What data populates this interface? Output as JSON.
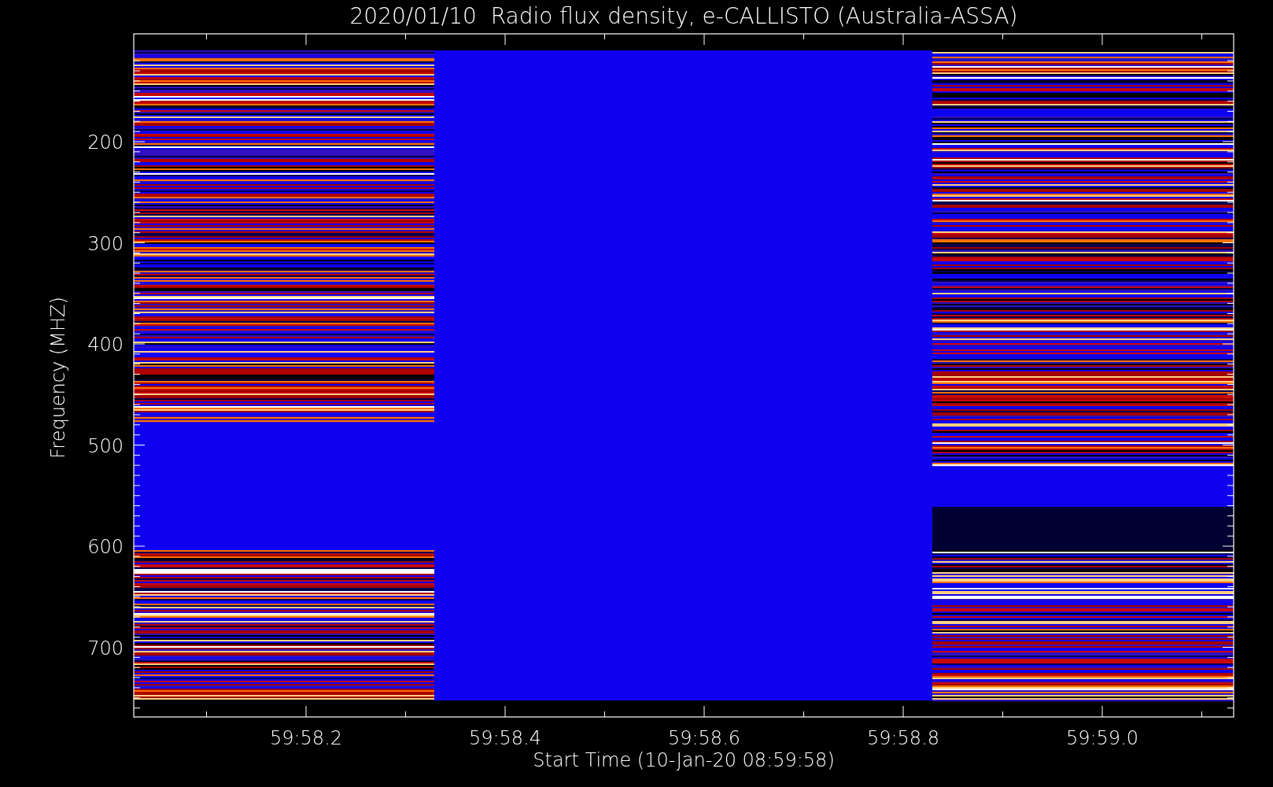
{
  "title": "2020/01/10  Radio flux density, e-CALLISTO (Australia-ASSA)",
  "xlabel": "Start Time (10-Jan-20 08:59:58)",
  "ylabel": "Frequency (MHZ)",
  "xticks": [
    "59:58.2",
    "59:58.4",
    "59:58.6",
    "59:58.8",
    "59:59.0"
  ],
  "yticks": [
    "200",
    "300",
    "400",
    "500",
    "600",
    "700"
  ]
}
